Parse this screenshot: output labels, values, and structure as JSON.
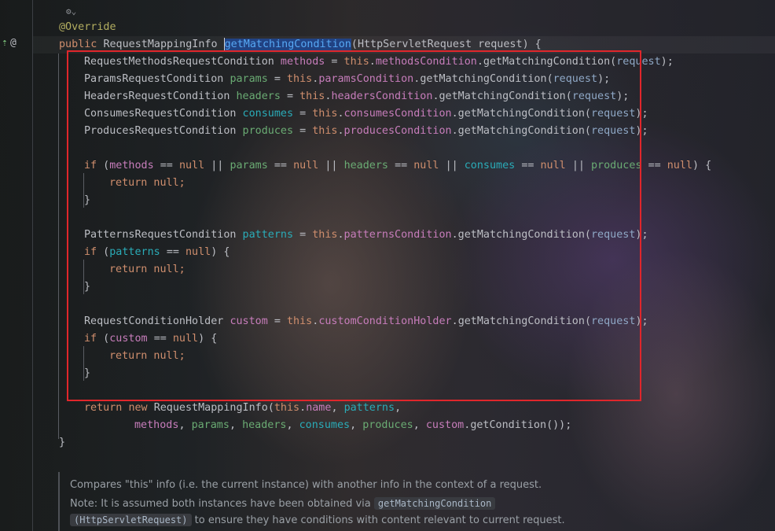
{
  "editor": {
    "annotation": "@Override",
    "signature": {
      "kw_public": "public",
      "return_type": "RequestMappingInfo",
      "method_name": "getMatchingCondition",
      "param_open": "(",
      "param_type": "HttpServletRequest",
      "param_name": "request",
      "param_close": ") {"
    },
    "decl_lines": [
      {
        "type": "RequestMethodsRequestCondition",
        "var": "methods",
        "field": "methodsCondition",
        "call": "getMatchingCondition",
        "arg": "request"
      },
      {
        "type": "ParamsRequestCondition",
        "var": "params",
        "field": "paramsCondition",
        "call": "getMatchingCondition",
        "arg": "request"
      },
      {
        "type": "HeadersRequestCondition",
        "var": "headers",
        "field": "headersCondition",
        "call": "getMatchingCondition",
        "arg": "request"
      },
      {
        "type": "ConsumesRequestCondition",
        "var": "consumes",
        "field": "consumesCondition",
        "call": "getMatchingCondition",
        "arg": "request"
      },
      {
        "type": "ProducesRequestCondition",
        "var": "produces",
        "field": "producesCondition",
        "call": "getMatchingCondition",
        "arg": "request"
      }
    ],
    "if_all_null": {
      "kw_if": "if",
      "vars": [
        "methods",
        "params",
        "headers",
        "consumes",
        "produces"
      ],
      "op": "==",
      "null": "null",
      "or": "||"
    },
    "return_null": "return null;",
    "close_brace": "}",
    "patterns_line": {
      "type": "PatternsRequestCondition",
      "var": "patterns",
      "field": "patternsCondition",
      "call": "getMatchingCondition",
      "arg": "request"
    },
    "if_patterns": {
      "var": "patterns"
    },
    "custom_line": {
      "type": "RequestConditionHolder",
      "var": "custom",
      "field": "customConditionHolder",
      "call": "getMatchingCondition",
      "arg": "request"
    },
    "if_custom": {
      "var": "custom"
    },
    "return_stmt": {
      "kw_return": "return",
      "kw_new": "new",
      "ctor": "RequestMappingInfo",
      "this": "this",
      "name_field": "name",
      "cont_args": [
        "methods",
        "params",
        "headers",
        "consumes",
        "produces"
      ],
      "custom_call": "custom",
      "get_condition": "getCondition"
    },
    "kw_this": "this",
    "method_close": "}"
  },
  "doc": {
    "line1": "Compares \"this\" info (i.e. the current instance) with another info in the context of a request.",
    "line2_prefix": "Note: It is assumed both instances have been obtained via",
    "line2_code": "getMatchingCondition",
    "line3_code": "(HttpServletRequest)",
    "line3_suffix": "to ensure they have conditions with content relevant to current request."
  },
  "gutter": {
    "override_icon": "override-up-icon",
    "at_icon": "annotation-at-icon",
    "fold_icon": "fold-hint-icon"
  },
  "colors": {
    "highlight_box": "#e0262b",
    "keyword": "#cf8e6d",
    "annotation": "#b3ae60",
    "field": "#c77dbb",
    "selection": "#214283"
  }
}
